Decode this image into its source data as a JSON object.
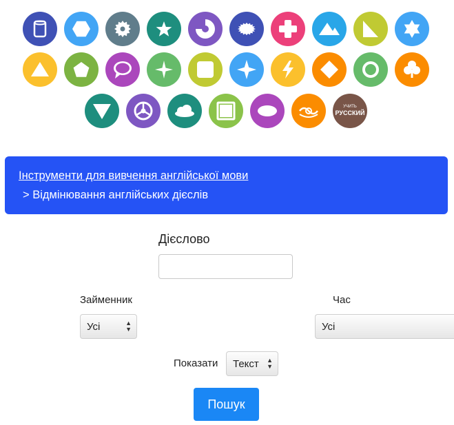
{
  "icons": [
    [
      {
        "name": "cylinder-icon",
        "color": "#3f51b5",
        "glyph": "cylinder"
      },
      {
        "name": "hexagon-icon",
        "color": "#42a5f5",
        "glyph": "hexagon"
      },
      {
        "name": "gear-icon",
        "color": "#607d8b",
        "glyph": "gear"
      },
      {
        "name": "star-icon",
        "color": "#1e8e7e",
        "glyph": "star"
      },
      {
        "name": "pie-icon",
        "color": "#7e57c2",
        "glyph": "pie"
      },
      {
        "name": "seal-icon",
        "color": "#3f51b5",
        "glyph": "seal"
      },
      {
        "name": "plus-icon",
        "color": "#ec407a",
        "glyph": "plus"
      },
      {
        "name": "mountain-icon",
        "color": "#29a6e8",
        "glyph": "mountain"
      },
      {
        "name": "right-triangle-icon",
        "color": "#c0ca33",
        "glyph": "righttri"
      },
      {
        "name": "hexagram-icon",
        "color": "#42a5f5",
        "glyph": "hexagram"
      }
    ],
    [
      {
        "name": "triangle-icon",
        "color": "#fbc02d",
        "glyph": "triangle"
      },
      {
        "name": "pentagon-icon",
        "color": "#7cb342",
        "glyph": "pentagon"
      },
      {
        "name": "speech-bubble-icon",
        "color": "#ab47bc",
        "glyph": "bubble"
      },
      {
        "name": "sparkle-icon",
        "color": "#66bb6a",
        "glyph": "sparkle"
      },
      {
        "name": "rounded-square-icon",
        "color": "#c0ca33",
        "glyph": "roundsq"
      },
      {
        "name": "four-point-star-icon",
        "color": "#42a5f5",
        "glyph": "star4"
      },
      {
        "name": "lightning-icon",
        "color": "#fbc02d",
        "glyph": "lightning"
      },
      {
        "name": "diamond-icon",
        "color": "#fb8c00",
        "glyph": "diamond"
      },
      {
        "name": "ring-icon",
        "color": "#66bb6a",
        "glyph": "ring"
      },
      {
        "name": "club-icon",
        "color": "#fb8c00",
        "glyph": "club"
      }
    ],
    [
      {
        "name": "down-triangle-icon",
        "color": "#1e8e7e",
        "glyph": "downtri"
      },
      {
        "name": "steering-wheel-icon",
        "color": "#7e57c2",
        "glyph": "wheel"
      },
      {
        "name": "cloud-icon",
        "color": "#1e8e7e",
        "glyph": "cloud"
      },
      {
        "name": "square-icon",
        "color": "#8bc34a",
        "glyph": "square"
      },
      {
        "name": "ellipse-icon",
        "color": "#ab47bc",
        "glyph": "ellipse"
      },
      {
        "name": "swirl-icon",
        "color": "#fb8c00",
        "glyph": "swirl"
      },
      {
        "name": "learn-russian-logo-icon",
        "color": "#795548",
        "glyph": "logo",
        "logo_text": [
          "УЧИТЬ",
          "РУССКИЙ"
        ]
      }
    ]
  ],
  "banner": {
    "link_text": "Інструменти для вивчення англійської мови",
    "subtitle": "> Відмінювання англійських дієслів"
  },
  "form": {
    "verb_label": "Дієслово",
    "verb_value": "",
    "pronoun_label": "Займенник",
    "pronoun_selected": "Усі",
    "tense_label": "Час",
    "tense_selected": "Усі",
    "show_label": "Показати",
    "show_selected": "Текст",
    "search_button": "Пошук"
  }
}
